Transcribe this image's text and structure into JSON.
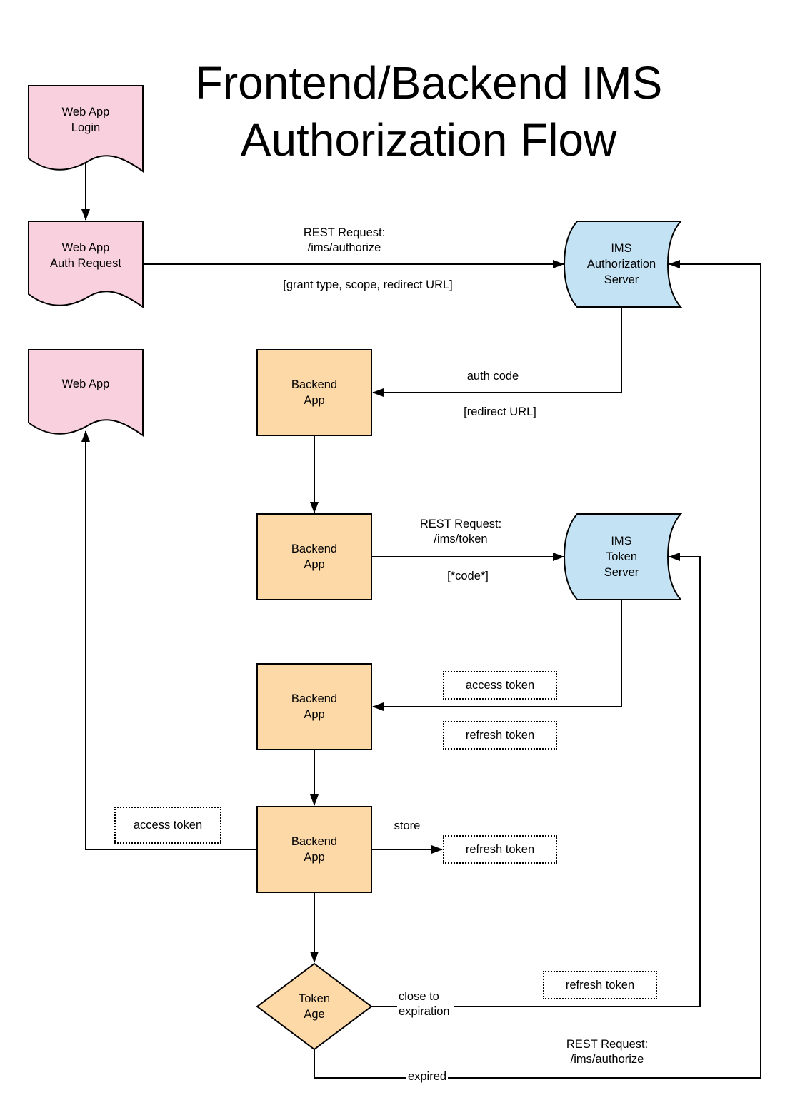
{
  "title": {
    "line1": "Frontend/Backend IMS",
    "line2": "Authorization Flow"
  },
  "colors": {
    "web_app_fill": "#f9d0dd",
    "backend_fill": "#fdd9a8",
    "server_fill": "#c3e3f5",
    "stroke": "#000000"
  },
  "nodes": {
    "web_app_login": "Web App\nLogin",
    "web_app_auth_request": "Web App\nAuth Request",
    "web_app": "Web App",
    "ims_authorization_server": "IMS\nAuthorization\nServer",
    "ims_token_server": "IMS\nToken\nServer",
    "backend_app_1": "Backend\nApp",
    "backend_app_2": "Backend\nApp",
    "backend_app_3": "Backend\nApp",
    "backend_app_4": "Backend\nApp",
    "token_age": "Token\nAge"
  },
  "edge_labels": {
    "authorize_request": "REST Request:\n/ims/authorize",
    "authorize_params": "[grant type, scope, redirect URL]",
    "auth_code": "auth code",
    "redirect_url": "[redirect URL]",
    "token_request": "REST Request:\n/ims/token",
    "token_params": "[*code*]",
    "store": "store",
    "close_to_expiration": "close to\nexpiration",
    "expired": "expired",
    "reauthorize_request": "REST Request:\n/ims/authorize"
  },
  "tokens": {
    "access_token_from_server": "access token",
    "refresh_token_from_server": "refresh token",
    "access_token_to_web_app": "access token",
    "refresh_token_stored": "refresh token",
    "refresh_token_renew": "refresh token"
  }
}
